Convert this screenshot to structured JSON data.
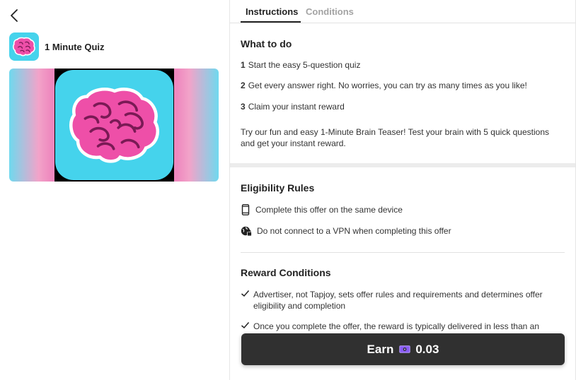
{
  "app": {
    "title": "1 Minute Quiz",
    "icon": "brain-icon",
    "brand_bg": "#45d3ec",
    "brain_color": "#ee4fa8"
  },
  "nav": {
    "back_icon": "chevron-left-icon"
  },
  "tabs": [
    {
      "label": "Instructions",
      "active": true
    },
    {
      "label": "Conditions",
      "active": false
    }
  ],
  "what_to_do": {
    "heading": "What to do",
    "steps": [
      {
        "num": "1",
        "text": "Start the easy 5-question quiz"
      },
      {
        "num": "2",
        "text": "Get every answer right. No worries, you can try as many times as you like!"
      },
      {
        "num": "3",
        "text": "Claim your instant reward"
      }
    ],
    "description": "Try our fun and easy 1-Minute Brain Teaser! Test your brain with 5 quick questions and get your instant reward."
  },
  "eligibility": {
    "heading": "Eligibility Rules",
    "rules": [
      {
        "icon": "phone-icon",
        "text": "Complete this offer on the same device"
      },
      {
        "icon": "globe-lock-icon",
        "text": "Do not connect to a VPN when completing this offer"
      }
    ]
  },
  "reward_conditions": {
    "heading": "Reward Conditions",
    "items": [
      "Advertiser, not Tapjoy, sets offer rules and requirements and determines offer eligibility and completion",
      "Once you complete the offer, the reward is typically delivered in less than an"
    ]
  },
  "earn": {
    "label": "Earn",
    "currency_icon": "cash-icon",
    "currency_color": "#8a5cf6",
    "amount": "0.03"
  }
}
